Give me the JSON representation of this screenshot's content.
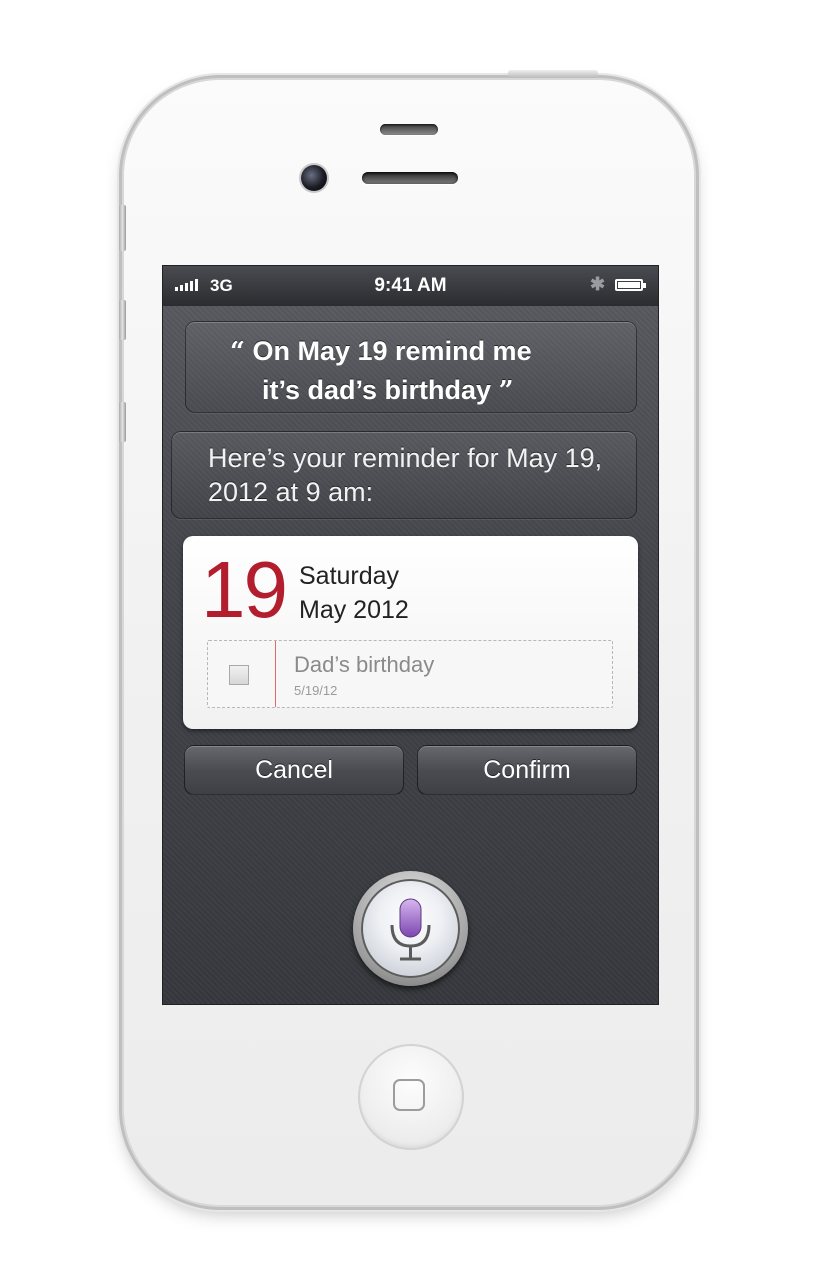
{
  "status_bar": {
    "network": "3G",
    "time": "9:41 AM",
    "bluetooth_icon": "bluetooth-icon",
    "battery_icon": "battery-icon",
    "signal_icon": "signal-bars-icon"
  },
  "conversation": {
    "user_line1": "On May 19 remind me",
    "user_line2": "it’s dad’s birthday",
    "open_quote": "“",
    "close_quote": "”",
    "assistant_text": "Here’s your reminder for May 19, 2012 at 9 am:"
  },
  "reminder_card": {
    "day_number": "19",
    "weekday": "Saturday",
    "month_year": "May 2012",
    "item_title": "Dad’s birthday",
    "item_date": "5/19/12",
    "accent_color": "#b21e2e"
  },
  "actions": {
    "cancel_label": "Cancel",
    "confirm_label": "Confirm"
  },
  "mic": {
    "icon": "microphone-icon",
    "tint_color": "#9d6ac9"
  }
}
